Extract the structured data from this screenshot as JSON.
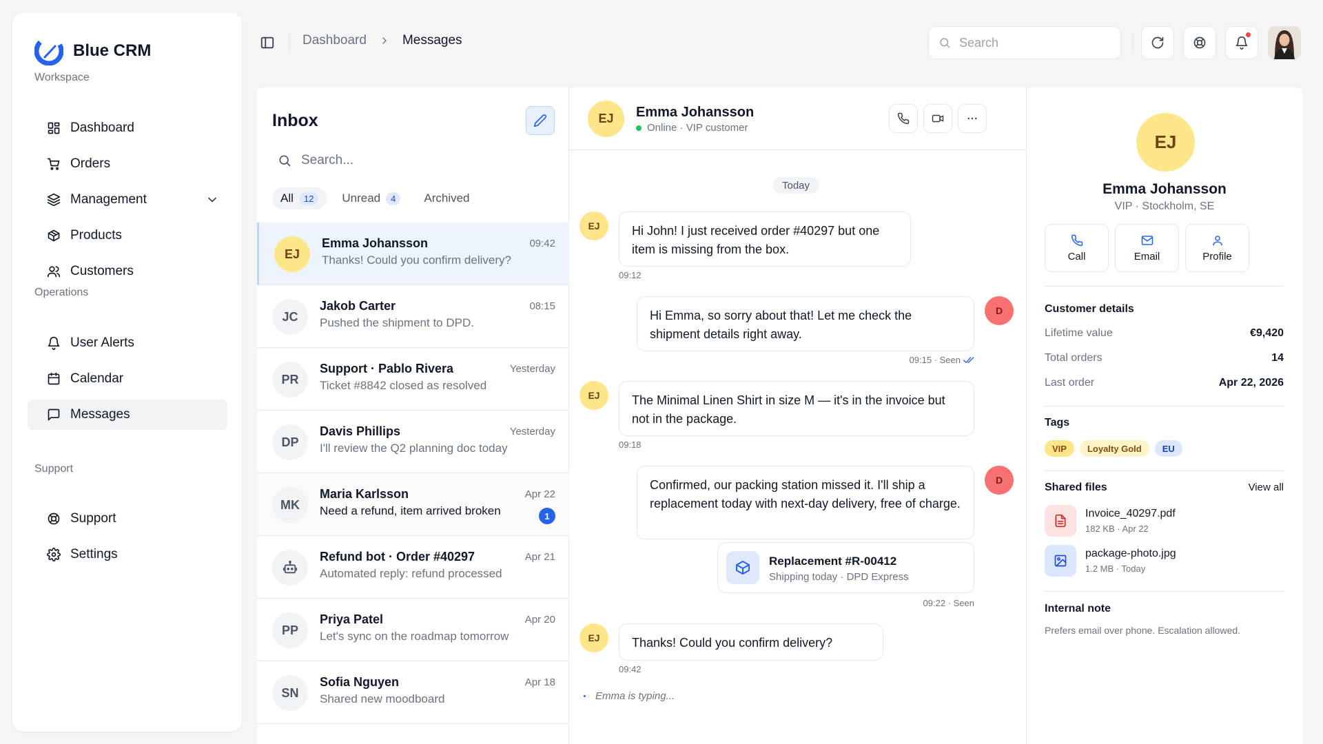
{
  "brand": {
    "name": "Blue CRM",
    "logo_color": "#2563eb"
  },
  "sidebar": {
    "sections": [
      {
        "title": "Workspace",
        "items": [
          {
            "label": "Dashboard",
            "icon": "grid-icon"
          },
          {
            "label": "Orders",
            "icon": "cart-icon"
          },
          {
            "label": "Management",
            "icon": "layers-icon",
            "expandable": true
          },
          {
            "label": "Products",
            "icon": "box-icon"
          },
          {
            "label": "Customers",
            "icon": "users-icon"
          }
        ]
      },
      {
        "title": "Operations",
        "items": [
          {
            "label": "User Alerts",
            "icon": "bell-icon"
          },
          {
            "label": "Calendar",
            "icon": "calendar-icon"
          },
          {
            "label": "Messages",
            "icon": "message-icon",
            "active": true
          }
        ]
      },
      {
        "title": "Support",
        "items": [
          {
            "label": "Support",
            "icon": "lifebuoy-icon"
          },
          {
            "label": "Settings",
            "icon": "gear-icon"
          }
        ]
      }
    ]
  },
  "header": {
    "breadcrumb": [
      "Dashboard",
      "Messages"
    ],
    "search_placeholder": "Search",
    "notification_dot_color": "#ef4444"
  },
  "inbox": {
    "title": "Inbox",
    "search_placeholder": "Search...",
    "filters": [
      {
        "label": "All",
        "count": "12",
        "active": true
      },
      {
        "label": "Unread",
        "count": "4"
      },
      {
        "label": "Archived",
        "count": ""
      }
    ],
    "conversations": [
      {
        "initials": "EJ",
        "name": "Emma Johansson",
        "preview": "Thanks! Could you confirm delivery?",
        "time": "09:42",
        "selected": true,
        "avatar": "yellow"
      },
      {
        "initials": "JC",
        "name": "Jakob Carter",
        "preview": "Pushed the shipment to DPD.",
        "time": "08:15"
      },
      {
        "initials": "PR",
        "name": "Support · Pablo Rivera",
        "preview": "Ticket #8842 closed as resolved",
        "time": "Yesterday"
      },
      {
        "initials": "DP",
        "name": "Davis Phillips",
        "preview": "I'll review the Q2 planning doc today",
        "time": "Yesterday"
      },
      {
        "initials": "MK",
        "name": "Maria Karlsson",
        "preview": "Need a refund, item arrived broken",
        "time": "Apr 22",
        "unread": "1"
      },
      {
        "initials": "",
        "icon": "bot-icon",
        "name": "Refund bot · Order #40297",
        "preview": "Automated reply: refund processed",
        "time": "Apr 21"
      },
      {
        "initials": "PP",
        "name": "Priya Patel",
        "preview": "Let's sync on the roadmap tomorrow",
        "time": "Apr 20"
      },
      {
        "initials": "SN",
        "name": "Sofia Nguyen",
        "preview": "Shared new moodboard",
        "time": "Apr 18"
      }
    ]
  },
  "chat": {
    "initials": "EJ",
    "name": "Emma Johansson",
    "status": "Online · VIP customer",
    "day": "Today",
    "messages": [
      {
        "from": "EJ",
        "text": "Hi John! I just received order #40297 but one item is missing from the box.",
        "time": "09:12"
      },
      {
        "from": "D",
        "text": "Hi Emma, so sorry about that! Let me check the shipment details right away.",
        "time": "09:15 · Seen"
      },
      {
        "from": "EJ",
        "text": "The Minimal Linen Shirt in size M — it's in the invoice but not in the package.",
        "time": "09:18"
      },
      {
        "from": "D",
        "text": "Confirmed, our packing station missed it. I'll ship a replacement today with next-day delivery, free of charge.",
        "time": "09:22 · Seen"
      },
      {
        "from": "EJ",
        "text": "Thanks! Could you confirm delivery?",
        "time": "09:42"
      }
    ],
    "attachment": {
      "title": "Replacement #R-00412",
      "subtitle": "Shipping today · DPD Express"
    },
    "typing": "Emma is typing..."
  },
  "customer": {
    "initials": "EJ",
    "name": "Emma Johansson",
    "subtitle": "VIP · Stockholm, SE",
    "actions": [
      "Call",
      "Email",
      "Profile"
    ],
    "details_title": "Customer details",
    "details": [
      {
        "label": "Lifetime value",
        "value": "€9,420"
      },
      {
        "label": "Total orders",
        "value": "14"
      },
      {
        "label": "Last order",
        "value": "Apr 22, 2026"
      }
    ],
    "tags_title": "Tags",
    "tags": [
      "VIP",
      "Loyalty Gold",
      "EU"
    ],
    "files_title": "Shared files",
    "view_all": "View all",
    "files": [
      {
        "name": "Invoice_40297.pdf",
        "meta": "182 KB · Apr 22"
      },
      {
        "name": "package-photo.jpg",
        "meta": "1.2 MB · Today"
      }
    ],
    "note_title": "Internal note",
    "note": "Prefers email over phone. Escalation allowed."
  }
}
